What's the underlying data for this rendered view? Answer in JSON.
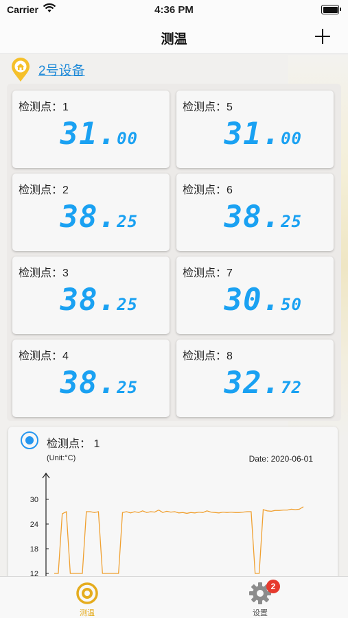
{
  "status_bar": {
    "carrier": "Carrier",
    "time": "4:36 PM"
  },
  "nav": {
    "title": "测温",
    "add_icon": "plus-icon"
  },
  "device": {
    "name": "2号设备",
    "icon": "location-home-pin-icon",
    "accent": "#f5c02a"
  },
  "points": [
    {
      "label": "检测点：1",
      "int": "31.",
      "dec": "00"
    },
    {
      "label": "检测点：5",
      "int": "31.",
      "dec": "00"
    },
    {
      "label": "检测点：2",
      "int": "38.",
      "dec": "25"
    },
    {
      "label": "检测点：6",
      "int": "38.",
      "dec": "25"
    },
    {
      "label": "检测点：3",
      "int": "38.",
      "dec": "25"
    },
    {
      "label": "检测点：7",
      "int": "30.",
      "dec": "50"
    },
    {
      "label": "检测点：4",
      "int": "38.",
      "dec": "25"
    },
    {
      "label": "检测点：8",
      "int": "32.",
      "dec": "72"
    }
  ],
  "value_color": "#1aa1f2",
  "chart": {
    "point_label": "检测点： 1",
    "unit": "(Unit:°C)",
    "date": "Date: 2020-06-01"
  },
  "chart_data": {
    "type": "line",
    "title": "",
    "xlabel": "",
    "ylabel": "(Unit:°C)",
    "ylim": [
      12,
      30
    ],
    "yticks": [
      12,
      18,
      24,
      30
    ],
    "color": "#f0a030",
    "series": [
      {
        "values": [
          12,
          12,
          26.5,
          27,
          12,
          12,
          12,
          12,
          27,
          27,
          26.8,
          27,
          12,
          12,
          12,
          12,
          12,
          26.8,
          27,
          26.7,
          27,
          26.8,
          27.2,
          26.8,
          27,
          26.9,
          27.4,
          26.8,
          27.1,
          26.9,
          27,
          26.7,
          26.8,
          26.6,
          26.8,
          26.7,
          26.9,
          26.8,
          27.2,
          26.9,
          26.8,
          26.7,
          26.9,
          26.8,
          26.9,
          26.8,
          26.8,
          26.9,
          27,
          27,
          12,
          12,
          27.5,
          27.2,
          27.1,
          27.3,
          27.3,
          27.4,
          27.4,
          27.6,
          27.5,
          27.6,
          28.2
        ]
      }
    ]
  },
  "tabs": [
    {
      "label": "测温",
      "icon": "thermometer-target-icon",
      "active": true
    },
    {
      "label": "设置",
      "icon": "gear-icon",
      "badge": "2",
      "active": false
    }
  ]
}
